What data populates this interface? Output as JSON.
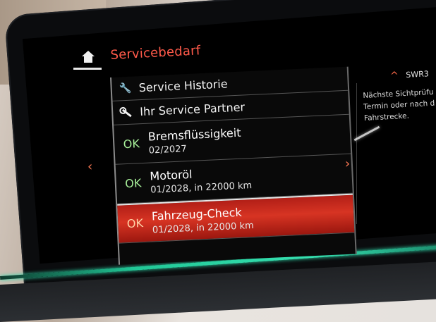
{
  "header": {
    "title": "Servicebedarf"
  },
  "menu": {
    "items": [
      {
        "label": "Service Historie",
        "icon": "service-history-icon"
      },
      {
        "label": "Ihr Service Partner",
        "icon": "wrench-icon"
      }
    ]
  },
  "services": [
    {
      "status": "OK",
      "name": "Bremsflüssigkeit",
      "due": "02/2027"
    },
    {
      "status": "OK",
      "name": "Motoröl",
      "due": "01/2028, in 22000 km"
    },
    {
      "status": "OK",
      "name": "Fahrzeug-Check",
      "due": "01/2028, in 22000 km"
    }
  ],
  "side_panel": {
    "tag": "SWR3",
    "help_lines": [
      "Nächste Sichtprüfu",
      "Termin oder nach d",
      "Fahrstrecke."
    ]
  },
  "colors": {
    "accent": "#ff5a4a",
    "ok": "#a8f09a",
    "selected_row": "#d73423",
    "ambient_light": "#2fe0b0"
  }
}
